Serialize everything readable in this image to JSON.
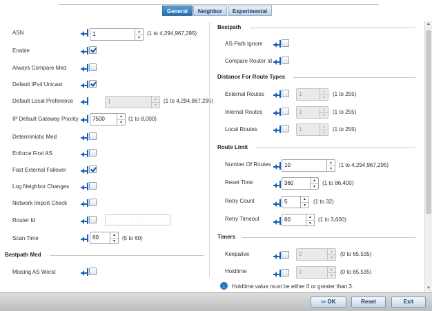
{
  "tabs": [
    {
      "label": "General",
      "active": true
    },
    {
      "label": "Neighbor",
      "active": false
    },
    {
      "label": "Experimental",
      "active": false
    }
  ],
  "left": {
    "asn": {
      "label": "ASN",
      "value": "1",
      "range": "(1 to 4,294,967,295)"
    },
    "enable": {
      "label": "Enable",
      "checked": true
    },
    "always_compare_med": {
      "label": "Always Compare Med",
      "checked": false
    },
    "default_ipv4_unicast": {
      "label": "Default IPv4 Unicast",
      "checked": true
    },
    "default_local_preference": {
      "label": "Default Local Preference",
      "value": "1",
      "range": "(1 to 4,294,967,295)"
    },
    "ip_default_gateway_priority": {
      "label": "IP Default Gateway Priority",
      "value": "7500",
      "range": "(1 to 8,000)"
    },
    "deterministic_med": {
      "label": "Deterministic Med",
      "checked": false
    },
    "enforce_first_as": {
      "label": "Enforce First AS",
      "checked": false
    },
    "fast_external_failover": {
      "label": "Fast External Failover",
      "checked": true
    },
    "log_neighbor_changes": {
      "label": "Log Neighbor Changes",
      "checked": false
    },
    "network_import_check": {
      "label": "Network Import Check",
      "checked": false
    },
    "router_id": {
      "label": "Router Id",
      "value": "...."
    },
    "scan_time": {
      "label": "Scan Time",
      "value": "60",
      "range": "(5 to 60)"
    },
    "bestpath_med": {
      "title": "Bestpath Med",
      "missing_as_worst": {
        "label": "Missing AS Worst",
        "checked": false
      }
    }
  },
  "right": {
    "bestpath": {
      "title": "Bestpath",
      "as_path_ignore": {
        "label": "AS-Path Ignore",
        "checked": false
      },
      "compare_router_id": {
        "label": "Compare Router Id",
        "checked": false
      }
    },
    "distance": {
      "title": "Distance For Route Types",
      "external": {
        "label": "External Routes",
        "value": "1",
        "range": "(1 to 255)"
      },
      "internal": {
        "label": "Internal Routes",
        "value": "1",
        "range": "(1 to 255)"
      },
      "local": {
        "label": "Local Routes",
        "value": "1",
        "range": "(1 to 255)"
      }
    },
    "route_limit": {
      "title": "Route Limit",
      "number_of_routes": {
        "label": "Number Of Routes",
        "value": "10",
        "range": "(1 to 4,294,967,295)"
      },
      "reset_time": {
        "label": "Reset Time",
        "value": "360",
        "range": "(1 to 86,400)"
      },
      "retry_count": {
        "label": "Retry Count",
        "value": "5",
        "range": "(1 to 32)"
      },
      "retry_timeout": {
        "label": "Retry Timeout",
        "value": "60",
        "range": "(1 to 3,600)"
      }
    },
    "timers": {
      "title": "Timers",
      "keepalive": {
        "label": "Keepalive",
        "value": "0",
        "range": "(0 to 65,535)"
      },
      "holdtime": {
        "label": "Holdtime",
        "value": "0",
        "range": "(0 to 65,535)"
      },
      "note": "Holdtime value must be either 0 or greater than 3."
    }
  },
  "footer": {
    "ok": "OK",
    "reset": "Reset",
    "exit": "Exit"
  },
  "colors": {
    "accent": "#2d6fab",
    "icon_blue": "#1a5fb4",
    "check": "#1a4f96"
  }
}
